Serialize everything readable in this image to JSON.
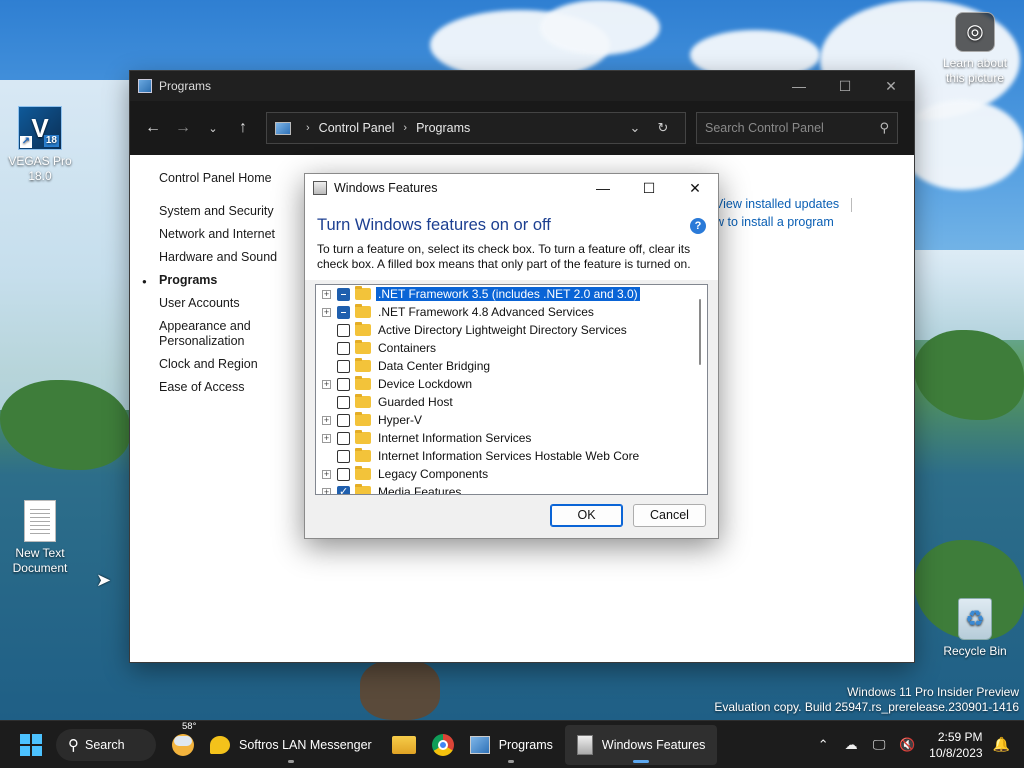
{
  "desktop": {
    "icons": {
      "vegas": {
        "label_line1": "VEGAS Pro",
        "label_line2": "18.0",
        "glyph": "V",
        "badge": "18"
      },
      "textdoc": {
        "label_line1": "New Text",
        "label_line2": "Document"
      },
      "recycle": {
        "label": "Recycle Bin"
      },
      "learn": {
        "label_line1": "Learn about",
        "label_line2": "this picture"
      }
    },
    "watermark": {
      "line1": "Windows 11 Pro Insider Preview",
      "line2": "Evaluation copy. Build 25947.rs_prerelease.230901-1416"
    }
  },
  "control_panel": {
    "title": "Programs",
    "breadcrumb": [
      "Control Panel",
      "Programs"
    ],
    "search_placeholder": "Search Control Panel",
    "left_nav": {
      "home": "Control Panel Home",
      "items": [
        "System and Security",
        "Network and Internet",
        "Hardware and Sound",
        "Programs",
        "User Accounts",
        "Appearance and Personalization",
        "Clock and Region",
        "Ease of Access"
      ],
      "active_index": 3
    },
    "right_links": {
      "view_updates": "View installed updates",
      "how_to_install": "w to install a program"
    }
  },
  "windows_features": {
    "title": "Windows Features",
    "heading": "Turn Windows features on or off",
    "description": "To turn a feature on, select its check box. To turn a feature off, clear its check box. A filled box means that only part of the feature is turned on.",
    "features": [
      {
        "label": ".NET Framework 3.5 (includes .NET 2.0 and 3.0)",
        "expandable": true,
        "state": "partial",
        "selected": true
      },
      {
        "label": ".NET Framework 4.8 Advanced Services",
        "expandable": true,
        "state": "partial",
        "selected": false
      },
      {
        "label": "Active Directory Lightweight Directory Services",
        "expandable": false,
        "state": "off",
        "selected": false
      },
      {
        "label": "Containers",
        "expandable": false,
        "state": "off",
        "selected": false
      },
      {
        "label": "Data Center Bridging",
        "expandable": false,
        "state": "off",
        "selected": false
      },
      {
        "label": "Device Lockdown",
        "expandable": true,
        "state": "off",
        "selected": false
      },
      {
        "label": "Guarded Host",
        "expandable": false,
        "state": "off",
        "selected": false
      },
      {
        "label": "Hyper-V",
        "expandable": true,
        "state": "off",
        "selected": false
      },
      {
        "label": "Internet Information Services",
        "expandable": true,
        "state": "off",
        "selected": false
      },
      {
        "label": "Internet Information Services Hostable Web Core",
        "expandable": false,
        "state": "off",
        "selected": false
      },
      {
        "label": "Legacy Components",
        "expandable": true,
        "state": "off",
        "selected": false
      },
      {
        "label": "Media Features",
        "expandable": true,
        "state": "checked",
        "selected": false
      }
    ],
    "ok_label": "OK",
    "cancel_label": "Cancel"
  },
  "taskbar": {
    "search_label": "Search",
    "weather_temp": "58°",
    "apps": {
      "messenger": "Softros LAN Messenger",
      "programs": "Programs",
      "windows_features": "Windows Features"
    },
    "time": "2:59 PM",
    "date": "10/8/2023"
  },
  "colors": {
    "accent": "#0a64d6",
    "heading": "#1c3f91",
    "taskbar": "#1c1c1c",
    "link": "#0a5fb4"
  }
}
